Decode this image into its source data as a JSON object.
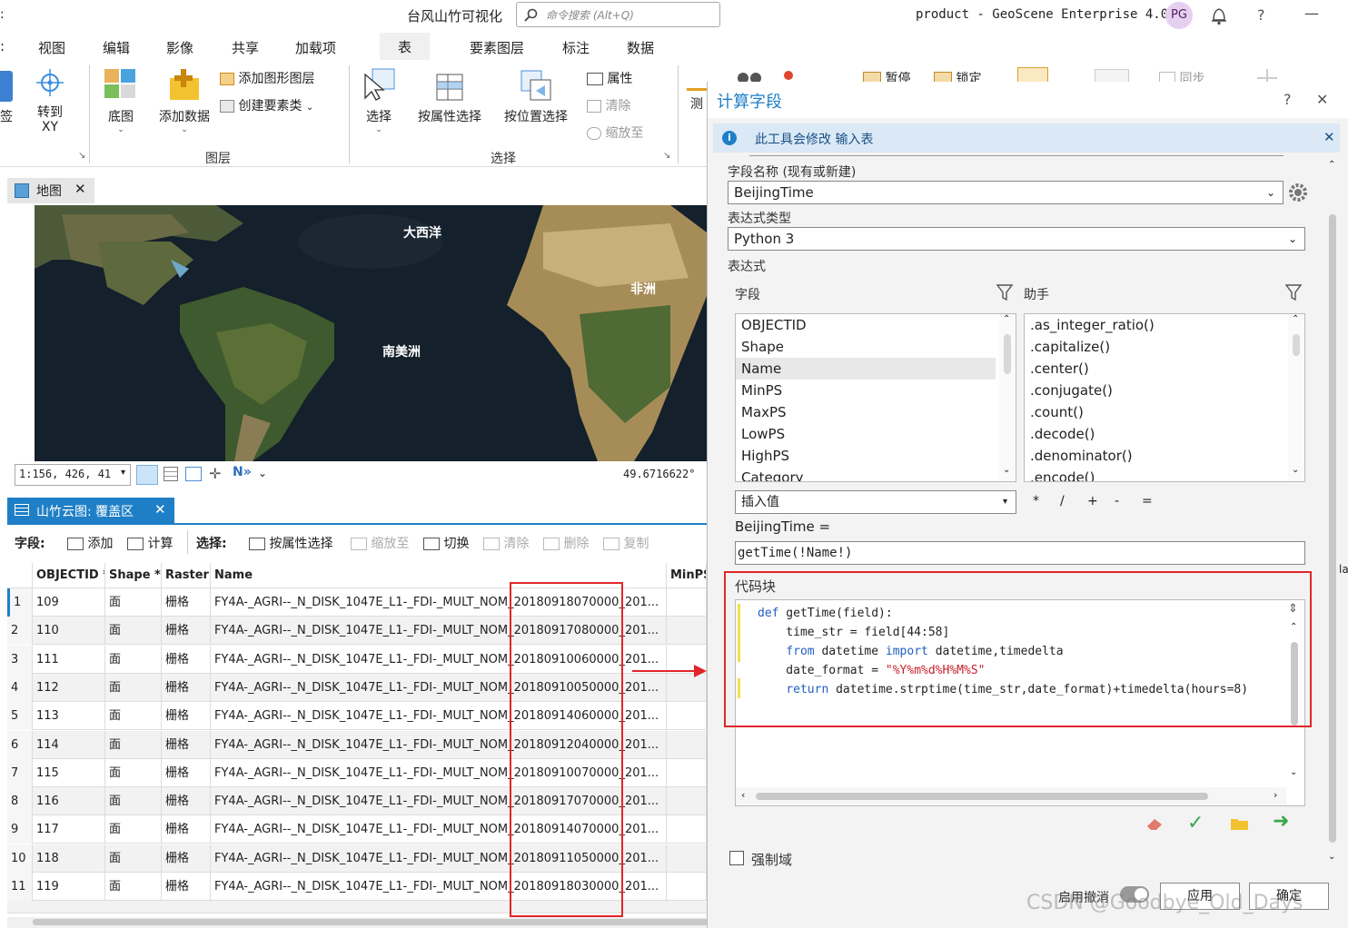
{
  "titlebar": {
    "project": "台风山竹可视化",
    "search_placeholder": "命令搜索 (Alt+Q)",
    "product": "product - GeoScene Enterprise 4.0",
    "user_initials": "PG",
    "help": "?",
    "minimize": "—"
  },
  "ribbon_tabs": [
    "视图",
    "编辑",
    "影像",
    "共享",
    "加载项",
    "表",
    "要素图层",
    "标注",
    "数据"
  ],
  "ribbon": {
    "goto_xy": "转到\nXY",
    "basemap": "底图",
    "add_data": "添加数据",
    "add_graphics_layer": "添加图形图层",
    "create_feature_class": "创建要素类",
    "layer_group": "图层",
    "select": "选择",
    "select_by_attr": "按属性选择",
    "select_by_loc": "按位置选择",
    "attributes": "属性",
    "clear": "清除",
    "zoom_to": "缩放至",
    "select_group": "选择",
    "measure": "测",
    "pause": "暂停",
    "lock": "锁定",
    "sync": "同步"
  },
  "map": {
    "tab_label": "地图",
    "labels": [
      "大西洋",
      "非洲",
      "南美洲"
    ],
    "scale": "1:156, 426, 41",
    "coord": "49.6716622°"
  },
  "table": {
    "tab_label": "山竹云图: 覆盖区",
    "toolbar": {
      "field_label": "字段:",
      "add": "添加",
      "calculate": "计算",
      "select_label": "选择:",
      "select_by_attr": "按属性选择",
      "zoom_to": "缩放至",
      "switch": "切换",
      "clear": "清除",
      "delete": "删除",
      "copy": "复制"
    },
    "columns": [
      "OBJECTID *",
      "Shape *",
      "Raster",
      "Name",
      "MinPS"
    ],
    "rows": [
      {
        "n": "1",
        "id": "109",
        "shape": "面",
        "raster": "栅格",
        "prefix": "FY4A-_AGRI--_N_DISK_1047E_L1-_FDI-_MULT_NOM_",
        "ts": "20180918070000",
        "suffix": "_201..."
      },
      {
        "n": "2",
        "id": "110",
        "shape": "面",
        "raster": "栅格",
        "prefix": "FY4A-_AGRI--_N_DISK_1047E_L1-_FDI-_MULT_NOM_",
        "ts": "20180917080000",
        "suffix": "_201..."
      },
      {
        "n": "3",
        "id": "111",
        "shape": "面",
        "raster": "栅格",
        "prefix": "FY4A-_AGRI--_N_DISK_1047E_L1-_FDI-_MULT_NOM_",
        "ts": "20180910060000",
        "suffix": "_201..."
      },
      {
        "n": "4",
        "id": "112",
        "shape": "面",
        "raster": "栅格",
        "prefix": "FY4A-_AGRI--_N_DISK_1047E_L1-_FDI-_MULT_NOM_",
        "ts": "20180910050000",
        "suffix": "_201..."
      },
      {
        "n": "5",
        "id": "113",
        "shape": "面",
        "raster": "栅格",
        "prefix": "FY4A-_AGRI--_N_DISK_1047E_L1-_FDI-_MULT_NOM_",
        "ts": "20180914060000",
        "suffix": "_201..."
      },
      {
        "n": "6",
        "id": "114",
        "shape": "面",
        "raster": "栅格",
        "prefix": "FY4A-_AGRI--_N_DISK_1047E_L1-_FDI-_MULT_NOM_",
        "ts": "20180912040000",
        "suffix": "_201..."
      },
      {
        "n": "7",
        "id": "115",
        "shape": "面",
        "raster": "栅格",
        "prefix": "FY4A-_AGRI--_N_DISK_1047E_L1-_FDI-_MULT_NOM_",
        "ts": "20180910070000",
        "suffix": "_201..."
      },
      {
        "n": "8",
        "id": "116",
        "shape": "面",
        "raster": "栅格",
        "prefix": "FY4A-_AGRI--_N_DISK_1047E_L1-_FDI-_MULT_NOM_",
        "ts": "20180917070000",
        "suffix": "_201..."
      },
      {
        "n": "9",
        "id": "117",
        "shape": "面",
        "raster": "栅格",
        "prefix": "FY4A-_AGRI--_N_DISK_1047E_L1-_FDI-_MULT_NOM_",
        "ts": "20180914070000",
        "suffix": "_201..."
      },
      {
        "n": "10",
        "id": "118",
        "shape": "面",
        "raster": "栅格",
        "prefix": "FY4A-_AGRI--_N_DISK_1047E_L1-_FDI-_MULT_NOM_",
        "ts": "20180911050000",
        "suffix": "_201..."
      },
      {
        "n": "11",
        "id": "119",
        "shape": "面",
        "raster": "栅格",
        "prefix": "FY4A-_AGRI--_N_DISK_1047E_L1-_FDI-_MULT_NOM_",
        "ts": "20180918030000",
        "suffix": "_201..."
      }
    ]
  },
  "dialog": {
    "title": "计算字段",
    "help": "?",
    "close": "✕",
    "info": "此工具会修改 输入表",
    "field_name_label": "字段名称 (现有或新建)",
    "field_name_value": "BeijingTime",
    "expr_type_label": "表达式类型",
    "expr_type_value": "Python 3",
    "expression_label": "表达式",
    "fields_label": "字段",
    "helpers_label": "助手",
    "fields": [
      "OBJECTID",
      "Shape",
      "Name",
      "MinPS",
      "MaxPS",
      "LowPS",
      "HighPS",
      "Category"
    ],
    "helpers": [
      ".as_integer_ratio()",
      ".capitalize()",
      ".center()",
      ".conjugate()",
      ".count()",
      ".decode()",
      ".denominator()",
      ".encode()"
    ],
    "insert_value": "插入值",
    "operators": [
      "*",
      "/",
      "+",
      "-",
      "="
    ],
    "expr_target": "BeijingTime =",
    "expression": "getTime(!Name!)",
    "code_block_label": "代码块",
    "code": {
      "l1_kw": "def",
      "l1": " getTime(field):",
      "l2": "    time_str = field[44:58]",
      "l3_kw1": "from",
      "l3_a": " datetime ",
      "l3_kw2": "import",
      "l3_b": " datetime,timedelta",
      "l4": "    date_format = ",
      "l4_str": "\"%Y%m%d%H%M%S\"",
      "l5_kw": "return",
      "l5": " datetime.strptime(time_str,date_format)+timedelta(hours=8)"
    },
    "enforce_domains": "强制域",
    "enable_undo": "启用撤消",
    "apply": "应用",
    "ok": "确定"
  },
  "watermark": "CSDN @Goodbye_Old_Days",
  "colors": {
    "accent": "#1f7fc6",
    "highlight": "#e0262a",
    "info_bg": "#dbe9f7"
  }
}
